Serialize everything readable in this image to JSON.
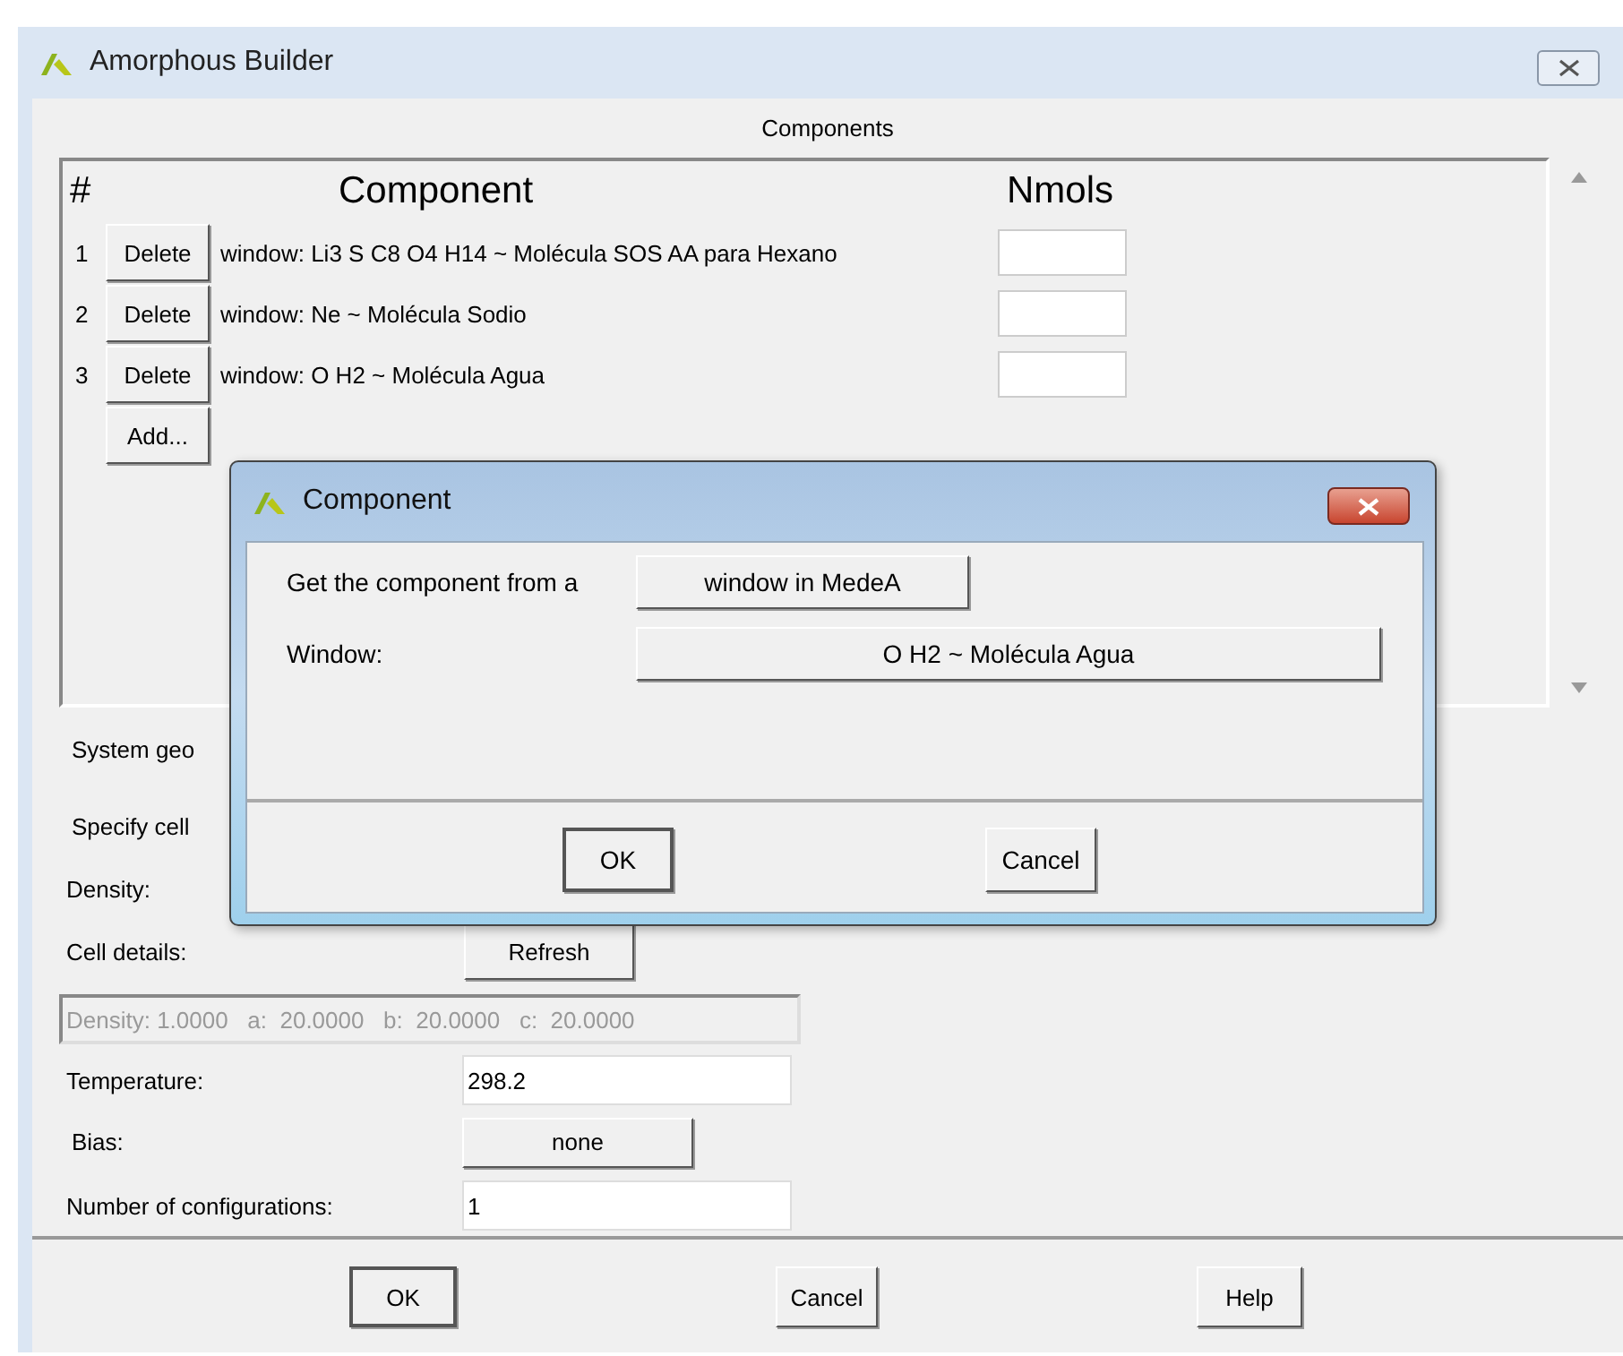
{
  "window": {
    "title": "Amorphous Builder"
  },
  "components": {
    "title": "Components",
    "columns": [
      "#",
      "Component",
      "Nmols"
    ],
    "rows": [
      {
        "number": "1",
        "button": "Delete",
        "component": "window: Li3 S C8 O4 H14 ~ Molécula SOS AA para Hexano"
      },
      {
        "number": "2",
        "button": "Delete",
        "component": "window: Ne ~ Molécula Sodio"
      },
      {
        "number": "3",
        "button": "Delete",
        "component": "window: O H2 ~ Molécula Agua"
      }
    ],
    "add_button": "Add..."
  },
  "system_geometry_label": "System geo",
  "specify_cell_label": "Specify cell",
  "density_label": "Density:",
  "cell_details": {
    "label": "Cell details:",
    "button": "Refresh",
    "summary": "Density: 1.0000   a:  20.0000   b:  20.0000   c:  20.0000"
  },
  "temperature": {
    "label": "Temperature:",
    "value": "298.2"
  },
  "bias": {
    "label": "Bias:",
    "button": "none"
  },
  "configurations": {
    "label": "Number of configurations:",
    "value": "1"
  },
  "buttons": [
    "OK",
    "Cancel",
    "Help"
  ],
  "dialog": {
    "title": "Component",
    "source_label": "Get the component from a",
    "source_button": "window in MedeA",
    "window_label": "Window:",
    "window_button": "O H2 ~ Molécula Agua",
    "buttons": [
      "OK",
      "Cancel"
    ]
  }
}
